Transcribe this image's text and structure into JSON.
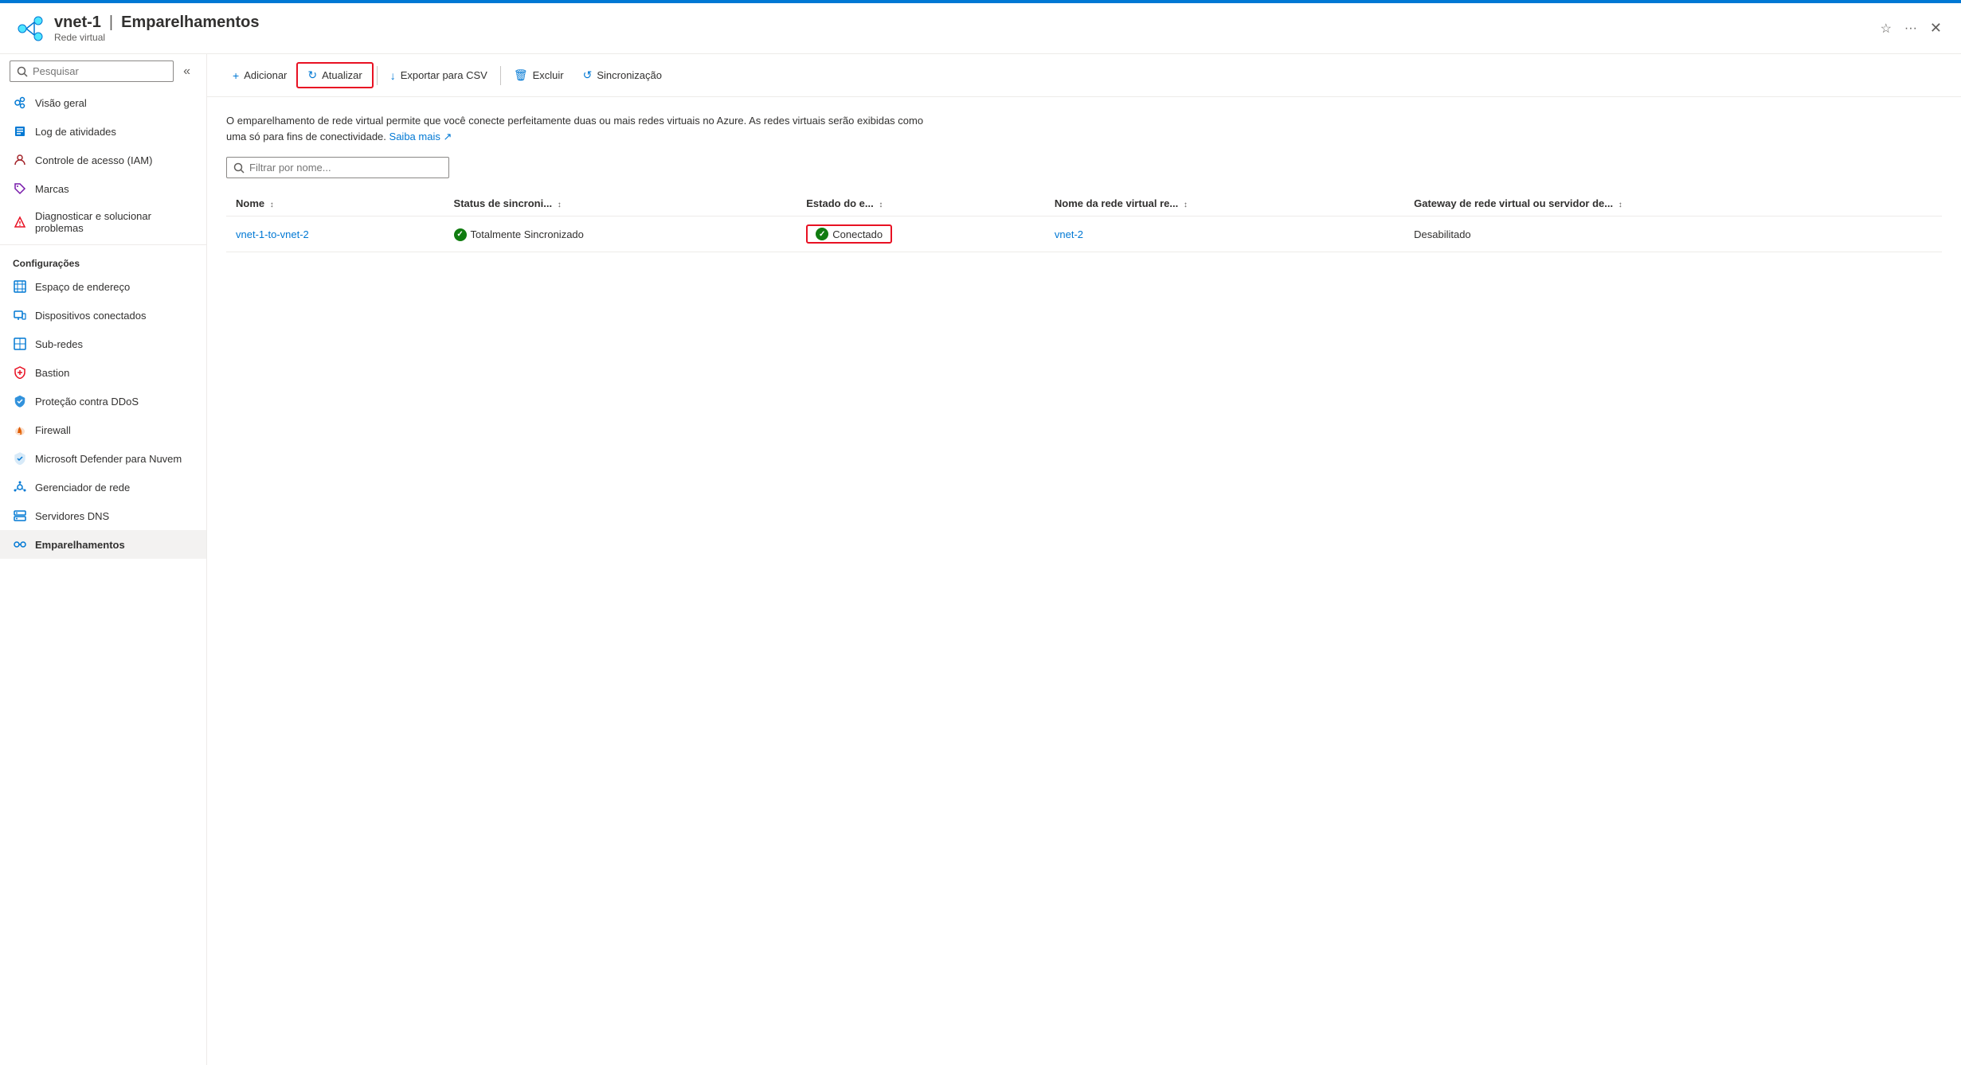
{
  "topbar": {
    "color": "#0078d4"
  },
  "header": {
    "resource_name": "vnet-1",
    "page_title": "Emparelhamentos",
    "resource_type": "Rede virtual",
    "star_label": "Favorito",
    "ellipsis_label": "Mais opções",
    "close_label": "Fechar"
  },
  "sidebar": {
    "search_placeholder": "Pesquisar",
    "collapse_tooltip": "Recolher painel",
    "nav_items": [
      {
        "id": "visao-geral",
        "label": "Visão geral",
        "icon": "vnet"
      },
      {
        "id": "log-atividades",
        "label": "Log de atividades",
        "icon": "log"
      },
      {
        "id": "controle-acesso",
        "label": "Controle de acesso (IAM)",
        "icon": "iam"
      },
      {
        "id": "marcas",
        "label": "Marcas",
        "icon": "tags"
      },
      {
        "id": "diagnosticar",
        "label": "Diagnosticar e solucionar problemas",
        "icon": "diag"
      }
    ],
    "section_configuracoes": "Configurações",
    "config_items": [
      {
        "id": "espaco-endereco",
        "label": "Espaço de endereço",
        "icon": "address"
      },
      {
        "id": "dispositivos-conectados",
        "label": "Dispositivos conectados",
        "icon": "devices"
      },
      {
        "id": "sub-redes",
        "label": "Sub-redes",
        "icon": "subnets"
      },
      {
        "id": "bastion",
        "label": "Bastion",
        "icon": "bastion"
      },
      {
        "id": "protecao-ddos",
        "label": "Proteção contra DDoS",
        "icon": "ddos"
      },
      {
        "id": "firewall",
        "label": "Firewall",
        "icon": "firewall"
      },
      {
        "id": "microsoft-defender",
        "label": "Microsoft Defender para Nuvem",
        "icon": "defender"
      },
      {
        "id": "gerenciador-rede",
        "label": "Gerenciador de rede",
        "icon": "network-mgr"
      },
      {
        "id": "servidores-dns",
        "label": "Servidores DNS",
        "icon": "dns"
      },
      {
        "id": "emparelhamentos",
        "label": "Emparelhamentos",
        "icon": "peerings",
        "active": true
      }
    ]
  },
  "toolbar": {
    "add_label": "Adicionar",
    "refresh_label": "Atualizar",
    "export_csv_label": "Exportar para CSV",
    "delete_label": "Excluir",
    "sync_label": "Sincronização"
  },
  "content": {
    "description": "O emparelhamento de rede virtual permite que você conecte perfeitamente duas ou mais redes virtuais no Azure. As redes virtuais serão exibidas como uma só para fins de conectividade.",
    "saiba_mais_label": "Saiba mais",
    "filter_placeholder": "Filtrar por nome...",
    "table": {
      "columns": [
        {
          "id": "nome",
          "label": "Nome"
        },
        {
          "id": "status-sincroni",
          "label": "Status de sincroni..."
        },
        {
          "id": "estado-e",
          "label": "Estado do e..."
        },
        {
          "id": "nome-rede-virtual",
          "label": "Nome da rede virtual re..."
        },
        {
          "id": "gateway",
          "label": "Gateway de rede virtual ou servidor de..."
        }
      ],
      "rows": [
        {
          "nome": "vnet-1-to-vnet-2",
          "status_sincronizacao": "Totalmente Sincronizado",
          "estado": "Conectado",
          "rede_virtual": "vnet-2",
          "gateway": "Desabilitado"
        }
      ]
    }
  }
}
